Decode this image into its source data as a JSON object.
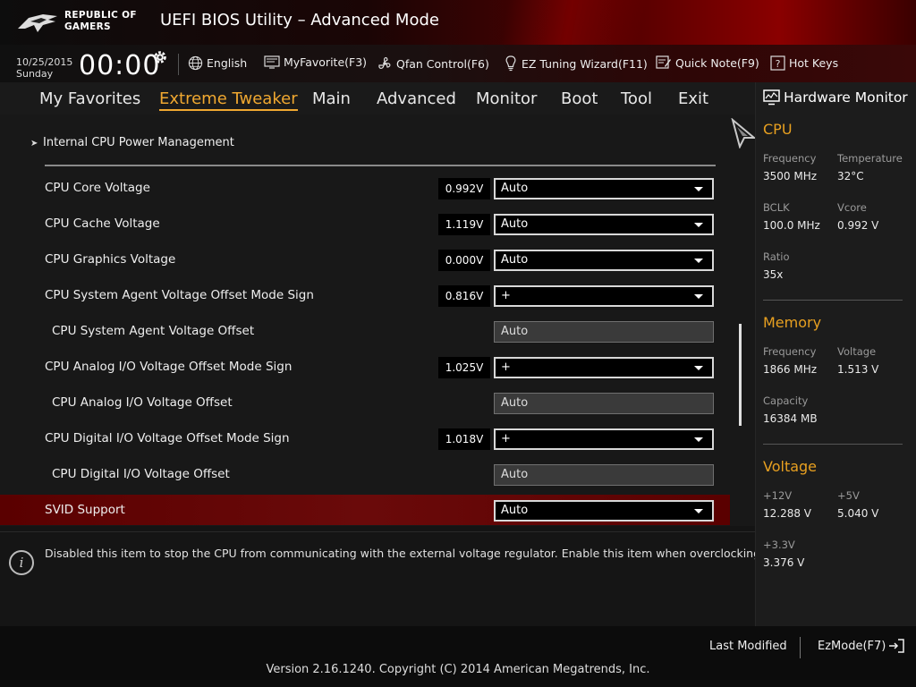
{
  "header": {
    "logo_line1": "REPUBLIC OF",
    "logo_line2": "GAMERS",
    "title": "UEFI BIOS Utility – Advanced Mode"
  },
  "infobar": {
    "date": "10/25/2015",
    "day": "Sunday",
    "time": "00:00",
    "items": [
      {
        "label": "English",
        "icon": "globe-icon"
      },
      {
        "label": "MyFavorite(F3)",
        "icon": "favorite-screen-icon"
      },
      {
        "label": "Qfan Control(F6)",
        "icon": "fan-icon"
      },
      {
        "label": "EZ Tuning Wizard(F11)",
        "icon": "bulb-icon"
      },
      {
        "label": "Quick Note(F9)",
        "icon": "note-icon"
      },
      {
        "label": "Hot Keys",
        "icon": "question-box-icon"
      }
    ]
  },
  "tabs": [
    "My Favorites",
    "Extreme Tweaker",
    "Main",
    "Advanced",
    "Monitor",
    "Boot",
    "Tool",
    "Exit"
  ],
  "active_tab": "Extreme Tweaker",
  "main": {
    "submenu": "Internal CPU Power Management",
    "rows": [
      {
        "label": "CPU Core Voltage",
        "voltage": "0.992V",
        "value": "Auto",
        "kind": "dropdown"
      },
      {
        "label": "CPU Cache Voltage",
        "voltage": "1.119V",
        "value": "Auto",
        "kind": "dropdown"
      },
      {
        "label": "CPU Graphics Voltage",
        "voltage": "0.000V",
        "value": "Auto",
        "kind": "dropdown"
      },
      {
        "label": "CPU System Agent Voltage Offset Mode Sign",
        "voltage": "0.816V",
        "value": "+",
        "kind": "dropdown"
      },
      {
        "label": "CPU System Agent Voltage Offset",
        "voltage": "",
        "value": "Auto",
        "kind": "text"
      },
      {
        "label": "CPU Analog I/O Voltage Offset Mode Sign",
        "voltage": "1.025V",
        "value": "+",
        "kind": "dropdown"
      },
      {
        "label": "CPU Analog I/O Voltage Offset",
        "voltage": "",
        "value": "Auto",
        "kind": "text"
      },
      {
        "label": "CPU Digital I/O Voltage Offset Mode Sign",
        "voltage": "1.018V",
        "value": "+",
        "kind": "dropdown"
      },
      {
        "label": "CPU Digital I/O Voltage Offset",
        "voltage": "",
        "value": "Auto",
        "kind": "text"
      },
      {
        "label": "SVID Support",
        "voltage": "",
        "value": "Auto",
        "kind": "dropdown",
        "selected": true
      }
    ]
  },
  "help": {
    "text": "Disabled this item to stop the CPU from communicating with the external voltage regulator. Enable this item when overclocking."
  },
  "hardware_monitor": {
    "title": "Hardware Monitor",
    "cpu": {
      "heading": "CPU",
      "frequency_label": "Frequency",
      "frequency": "3500 MHz",
      "temperature_label": "Temperature",
      "temperature": "32°C",
      "bclk_label": "BCLK",
      "bclk": "100.0 MHz",
      "vcore_label": "Vcore",
      "vcore": "0.992 V",
      "ratio_label": "Ratio",
      "ratio": "35x"
    },
    "memory": {
      "heading": "Memory",
      "frequency_label": "Frequency",
      "frequency": "1866 MHz",
      "voltage_label": "Voltage",
      "voltage": "1.513 V",
      "capacity_label": "Capacity",
      "capacity": "16384 MB"
    },
    "voltage": {
      "heading": "Voltage",
      "v12_label": "+12V",
      "v12": "12.288 V",
      "v5_label": "+5V",
      "v5": "5.040 V",
      "v33_label": "+3.3V",
      "v33": "3.376 V"
    }
  },
  "footer": {
    "last_modified": "Last Modified",
    "ezmode": "EzMode(F7)",
    "version": "Version 2.16.1240. Copyright (C) 2014 American Megatrends, Inc."
  },
  "colors": {
    "accent": "#f0a830",
    "highlight_row": "#5a0000",
    "brand_red": "#8a0000"
  }
}
